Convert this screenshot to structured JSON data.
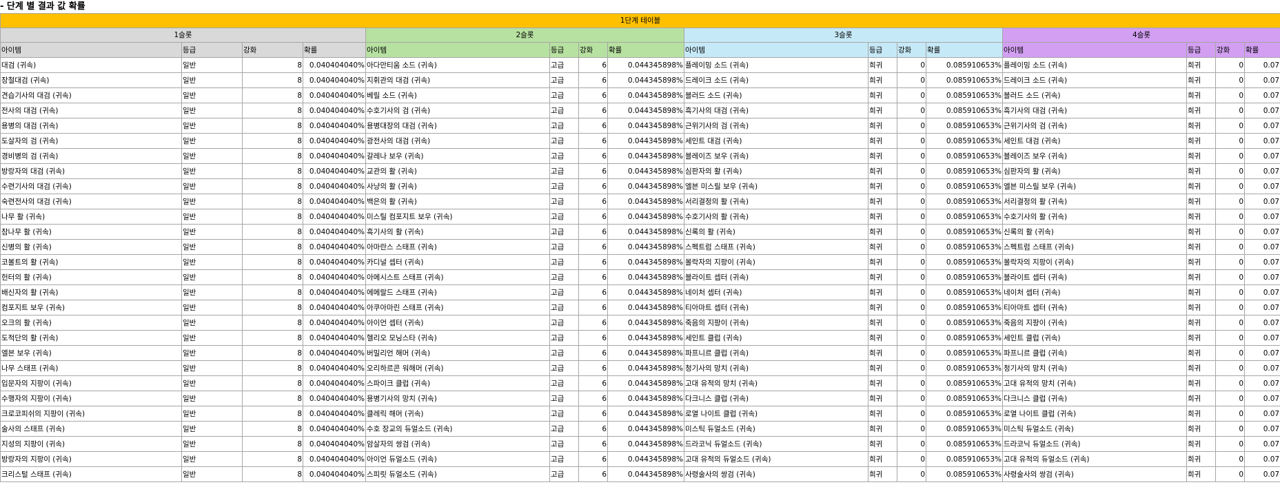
{
  "title": "- 단계 별 결과 값 확률",
  "banner": "1단계 테이블",
  "groups": [
    "1슬롯",
    "2슬롯",
    "3슬롯",
    "4슬롯"
  ],
  "headers": {
    "item": "아이템",
    "grade": "등급",
    "enhance": "강화",
    "prob": "확률"
  },
  "slot_values": [
    {
      "grade": "일반",
      "enhance": "8",
      "prob": "0.040404040%"
    },
    {
      "grade": "고급",
      "enhance": "6",
      "prob": "0.044345898%"
    },
    {
      "grade": "희귀",
      "enhance": "0",
      "prob": "0.085910653%"
    },
    {
      "grade": "희귀",
      "enhance": "0",
      "prob": "0.07"
    }
  ],
  "rows": [
    [
      "대검 (귀속)",
      "아다만티움 소드 (귀속)",
      "플레이밍 소드 (귀속)",
      "플레이밍 소드 (귀속)"
    ],
    [
      "장철대검 (귀속)",
      "지휘관의 대검 (귀속)",
      "드레이크 소드 (귀속)",
      "드레이크 소드 (귀속)"
    ],
    [
      "견습기사의 대검 (귀속)",
      "베릴 소드 (귀속)",
      "블러드 소드 (귀속)",
      "블러드 소드 (귀속)"
    ],
    [
      "전사의 대검 (귀속)",
      "수호기사의 검 (귀속)",
      "흑기사의 대검 (귀속)",
      "흑기사의 대검 (귀속)"
    ],
    [
      "용병의 대검 (귀속)",
      "용병대장의 대검 (귀속)",
      "근위기사의 검 (귀속)",
      "근위기사의 검 (귀속)"
    ],
    [
      "도살자의 검 (귀속)",
      "광전사의 대검 (귀속)",
      "세인트 대검 (귀속)",
      "세인트 대검 (귀속)"
    ],
    [
      "경비병의 검 (귀속)",
      "갈레나 보우 (귀속)",
      "블레이즈 보우 (귀속)",
      "블레이즈 보우 (귀속)"
    ],
    [
      "방랑자의 대검 (귀속)",
      "교관의 활 (귀속)",
      "심판자의 활 (귀속)",
      "심판자의 활 (귀속)"
    ],
    [
      "수련기사의 대검 (귀속)",
      "사냥의 활 (귀속)",
      "엘븐 미스릴 보우 (귀속)",
      "엘븐 미스릴 보우 (귀속)"
    ],
    [
      "숙련전사의 대검 (귀속)",
      "백은의 활 (귀속)",
      "서리결정의 활 (귀속)",
      "서리결정의 활 (귀속)"
    ],
    [
      "나무 활 (귀속)",
      "미스틸 컴포지트 보우 (귀속)",
      "수호기사의 활 (귀속)",
      "수호기사의 활 (귀속)"
    ],
    [
      "참나무 활 (귀속)",
      "흑기사의 활 (귀속)",
      "신록의 활 (귀속)",
      "신록의 활 (귀속)"
    ],
    [
      "신병의 활 (귀속)",
      "아마란스 스태프 (귀속)",
      "스펙트럼 스태프 (귀속)",
      "스펙트럼 스태프 (귀속)"
    ],
    [
      "코볼트의 활 (귀속)",
      "카디널 셉터 (귀속)",
      "몰락자의 지팡이 (귀속)",
      "몰락자의 지팡이 (귀속)"
    ],
    [
      "헌터의 활 (귀속)",
      "아메시스트 스태프 (귀속)",
      "블라이트 셉터 (귀속)",
      "블라이트 셉터 (귀속)"
    ],
    [
      "배신자의 활 (귀속)",
      "에메랄드 스태프 (귀속)",
      "네이처 셉터 (귀속)",
      "네이처 셉터 (귀속)"
    ],
    [
      "컴포지트 보우 (귀속)",
      "아쿠아마린 스태프 (귀속)",
      "티아마트 셉터 (귀속)",
      "티아마트 셉터 (귀속)"
    ],
    [
      "오크의 활 (귀속)",
      "아이언 셉터 (귀속)",
      "죽음의 지팡이 (귀속)",
      "죽음의 지팡이 (귀속)"
    ],
    [
      "도적단의 활 (귀속)",
      "헬리오 모닝스타 (귀속)",
      "세인트 클럽 (귀속)",
      "세인트 클럽 (귀속)"
    ],
    [
      "엘븐 보우 (귀속)",
      "버밀리언 해머 (귀속)",
      "파프니르 클럽 (귀속)",
      "파프니르 클럽 (귀속)"
    ],
    [
      "나무 스태프 (귀속)",
      "오리하르콘 워해머 (귀속)",
      "청기사의 망치 (귀속)",
      "청기사의 망치 (귀속)"
    ],
    [
      "입문자의 지팡이 (귀속)",
      "스파이크 클럽 (귀속)",
      "고대 유적의 망치 (귀속)",
      "고대 유적의 망치 (귀속)"
    ],
    [
      "수행자의 지팡이 (귀속)",
      "용병기사의 망치 (귀속)",
      "다크니스 클럽 (귀속)",
      "다크니스 클럽 (귀속)"
    ],
    [
      "크로코피쉬의 지팡이 (귀속)",
      "클레릭 해머 (귀속)",
      "로열 나이트 클럽 (귀속)",
      "로열 나이트 클럽 (귀속)"
    ],
    [
      "술사의 스태프 (귀속)",
      "수호 장교의 듀얼소드 (귀속)",
      "미스틱 듀얼소드 (귀속)",
      "미스틱 듀얼소드 (귀속)"
    ],
    [
      "지성의 지팡이 (귀속)",
      "암살자의 쌍검 (귀속)",
      "드라코닉 듀얼소드 (귀속)",
      "드라코닉 듀얼소드 (귀속)"
    ],
    [
      "방랑자의 지팡이 (귀속)",
      "아이언 듀얼소드 (귀속)",
      "고대 유적의 듀얼소드 (귀속)",
      "고대 유적의 듀얼소드 (귀속)"
    ],
    [
      "크리스털 스태프 (귀속)",
      "스피릿 듀얼소드 (귀속)",
      "사령술사의 쌍검 (귀속)",
      "사령술사의 쌍검 (귀속)"
    ]
  ]
}
